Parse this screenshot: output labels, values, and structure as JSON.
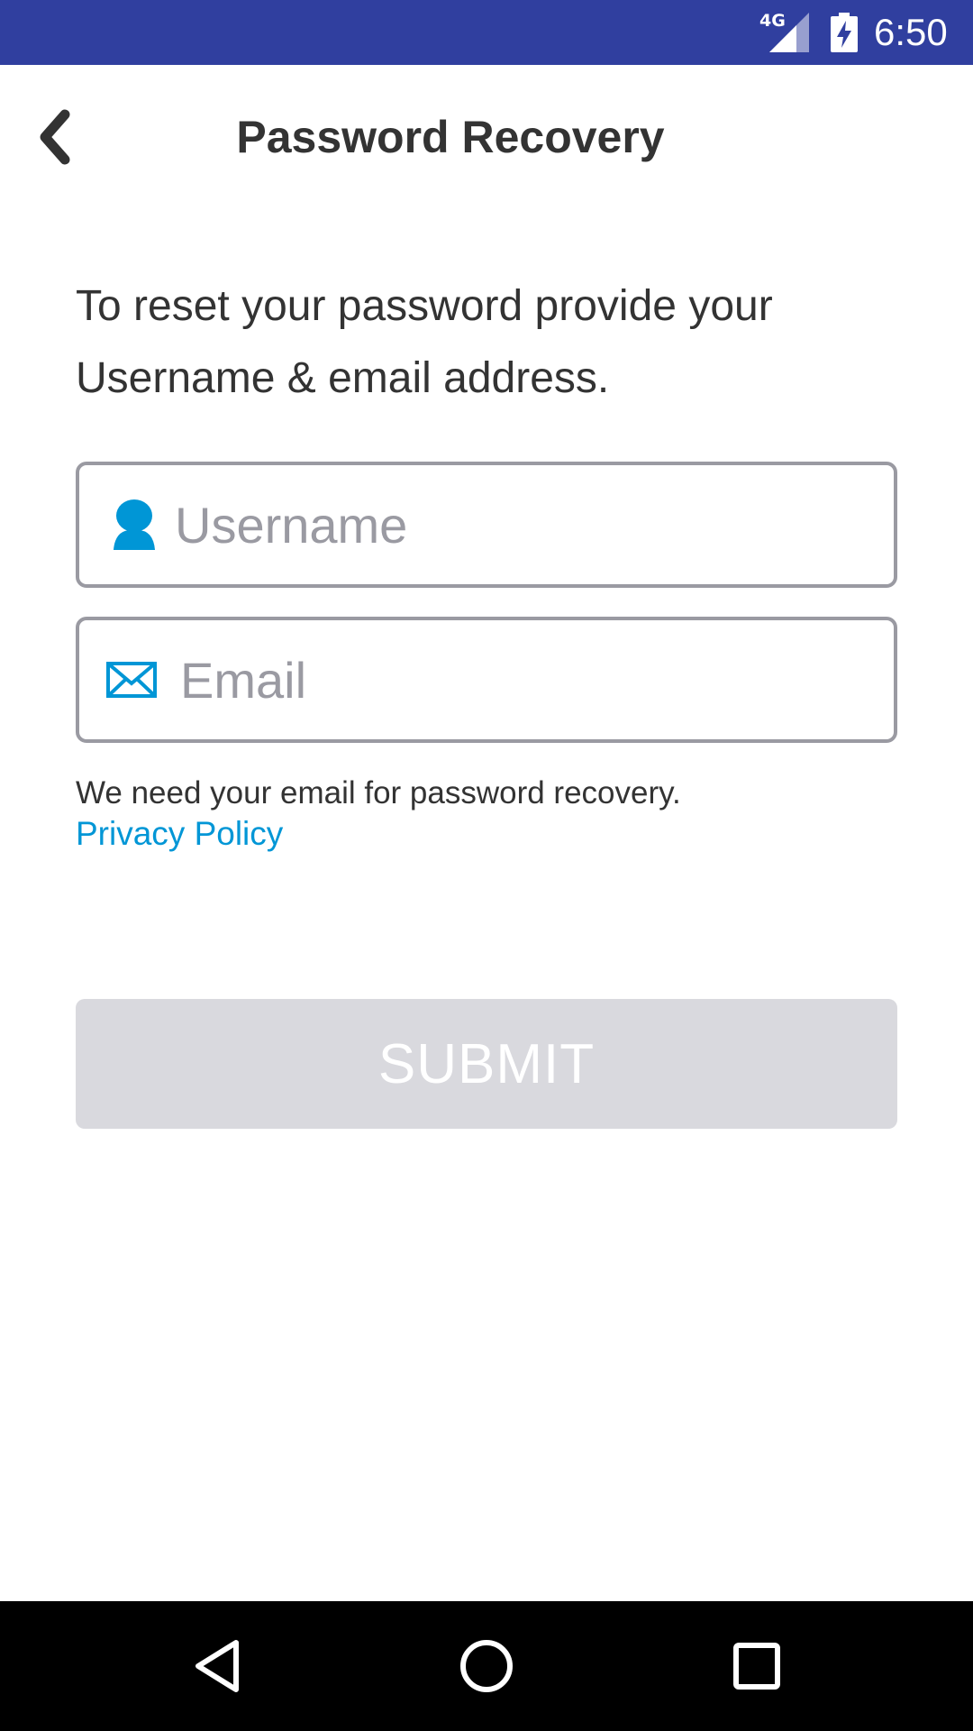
{
  "status_bar": {
    "network": "4G",
    "time": "6:50",
    "icons": [
      "signal-icon",
      "battery-charging-icon"
    ]
  },
  "header": {
    "title": "Password Recovery",
    "back_icon": "chevron-left-icon"
  },
  "intro_text": "To reset your password provide your Username & email address.",
  "form": {
    "username": {
      "placeholder": "Username",
      "value": "",
      "icon": "user-icon"
    },
    "email": {
      "placeholder": "Email",
      "value": "",
      "icon": "mail-icon"
    },
    "note": "We need your email for password recovery.",
    "privacy_link": "Privacy Policy",
    "submit_label": "SUBMIT"
  },
  "colors": {
    "status_bar": "#303f9f",
    "accent": "#0096d6",
    "field_border": "#9a9aa2",
    "button_disabled": "#d9d9de",
    "text": "#333333"
  },
  "nav_bar": {
    "icons": [
      "back-triangle-icon",
      "home-circle-icon",
      "recents-square-icon"
    ]
  }
}
